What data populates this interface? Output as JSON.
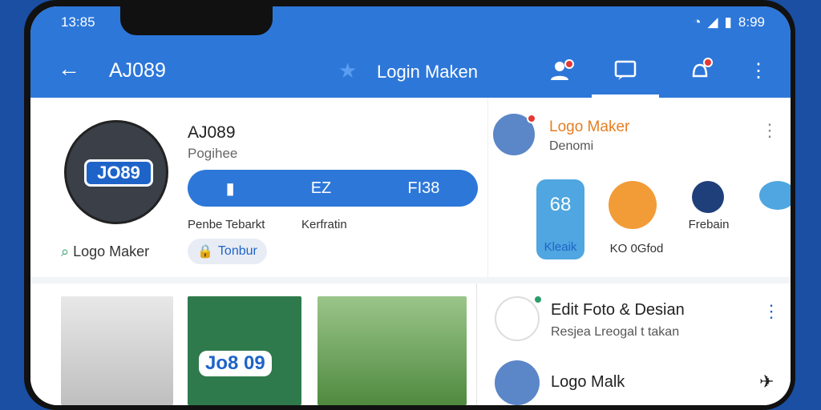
{
  "status": {
    "time": "13:85",
    "battery": "8:99"
  },
  "appbar": {
    "title": "AJ089",
    "center_label": "Login Maken"
  },
  "profile": {
    "avatar_text": "JO89",
    "name": "AJ089",
    "subtitle": "Pogihee",
    "stats": [
      {
        "icon": "bookmark-icon",
        "value": ""
      },
      {
        "icon": "ez",
        "value": "EZ"
      },
      {
        "icon": "f",
        "value": "FI38"
      }
    ],
    "stat_labels": [
      "Penbe Tebarkt",
      "Kerfratin"
    ],
    "logo_maker_label": "Logo Maker",
    "chip_label": "Tonbur"
  },
  "right_card": {
    "title": "Logo Maker",
    "subtitle": "Denomi",
    "tiles": [
      {
        "value": "68",
        "label": "Kleaik"
      },
      {
        "label": "KO 0Gfod"
      },
      {
        "label": "Frebain"
      }
    ]
  },
  "list": [
    {
      "title": "Edit Foto & Desian",
      "subtitle": "Resjea Lreogal t takan"
    },
    {
      "title": "Logo Malk"
    }
  ],
  "thumbs": [
    {
      "caption": ""
    },
    {
      "caption": "Jo8 09"
    },
    {
      "caption": ""
    }
  ],
  "colors": {
    "primary": "#2d77d9",
    "accent": "#e67e22"
  }
}
